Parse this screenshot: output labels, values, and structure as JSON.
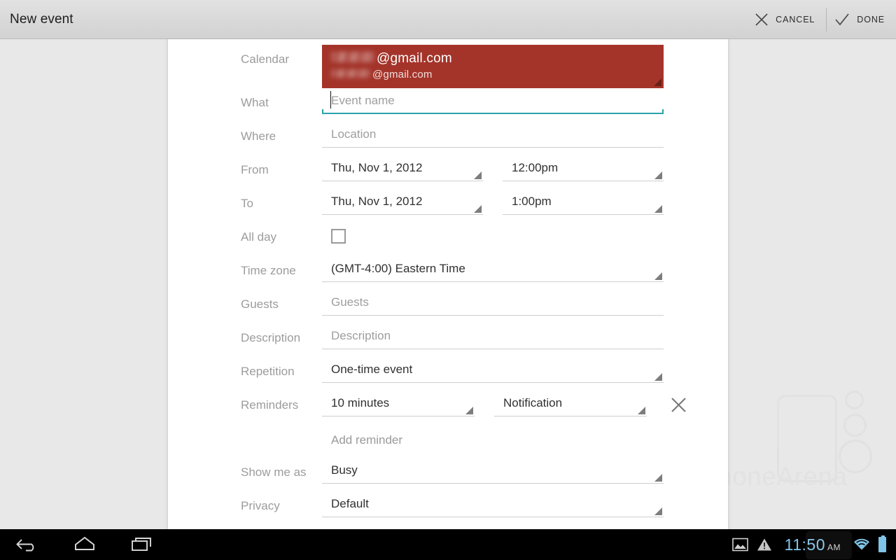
{
  "actionbar": {
    "title": "New event",
    "cancel_label": "CANCEL",
    "done_label": "DONE",
    "cancel_icon": "close-icon",
    "done_icon": "check-icon"
  },
  "form": {
    "calendar": {
      "label": "Calendar",
      "account_primary": "@gmail.com",
      "account_secondary": "@gmail.com",
      "color": "#a4342a",
      "redacted": true
    },
    "what": {
      "label": "What",
      "placeholder": "Event name",
      "value": "",
      "focused": true,
      "focus_color": "#2aa3ac"
    },
    "where": {
      "label": "Where",
      "placeholder": "Location",
      "value": ""
    },
    "from": {
      "label": "From",
      "date": "Thu, Nov 1, 2012",
      "time": "12:00pm"
    },
    "to": {
      "label": "To",
      "date": "Thu, Nov 1, 2012",
      "time": "1:00pm"
    },
    "allday": {
      "label": "All day",
      "checked": false
    },
    "timezone": {
      "label": "Time zone",
      "value": "(GMT-4:00) Eastern Time"
    },
    "guests": {
      "label": "Guests",
      "placeholder": "Guests",
      "value": ""
    },
    "description": {
      "label": "Description",
      "placeholder": "Description",
      "value": ""
    },
    "repetition": {
      "label": "Repetition",
      "value": "One-time event"
    },
    "reminders": {
      "label": "Reminders",
      "time_value": "10 minutes",
      "method_value": "Notification",
      "remove_icon": "close-icon",
      "add_label": "Add reminder"
    },
    "showmeas": {
      "label": "Show me as",
      "value": "Busy"
    },
    "privacy": {
      "label": "Privacy",
      "value": "Default"
    }
  },
  "watermark": {
    "text_light": "phone",
    "text_bold": "Arena"
  },
  "navbar": {
    "back_icon": "back-arrow-icon",
    "home_icon": "home-icon",
    "recents_icon": "recent-apps-icon",
    "screenshot_icon": "image-icon",
    "warning_icon": "warning-triangle-icon",
    "time": "11:50",
    "ampm": "AM",
    "wifi_icon": "wifi-icon",
    "battery_icon": "battery-icon",
    "accent": "#84c5e8"
  }
}
